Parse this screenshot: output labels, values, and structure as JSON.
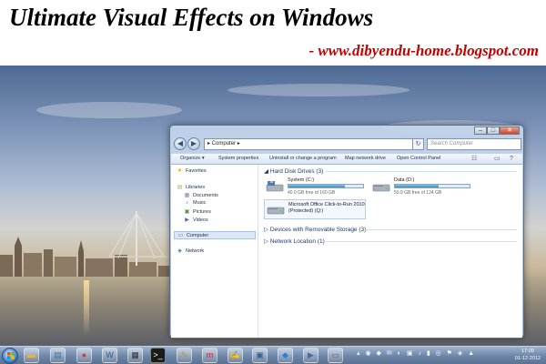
{
  "banner": {
    "title": "Ultimate Visual Effects on Windows",
    "url": "- www.dibyendu-home.blogspot.com"
  },
  "explorer": {
    "address": "▸ Computer ▸",
    "search_placeholder": "Search Computer",
    "toolbar": {
      "organize": "Organize ▾",
      "system_properties": "System properties",
      "uninstall": "Uninstall or change a program",
      "map_drive": "Map network drive",
      "control_panel": "Open Control Panel"
    },
    "sidebar": {
      "favorites": "Favorites",
      "libraries": "Libraries",
      "documents": "Documents",
      "music": "Music",
      "pictures": "Pictures",
      "videos": "Videos",
      "computer": "Computer",
      "network": "Network"
    },
    "groups": {
      "hard_disk": "Hard Disk Drives (3)",
      "removable": "Devices with Removable Storage (3)",
      "network_location": "Network Location (1)"
    },
    "drives": [
      {
        "name": "System (C:)",
        "free": "40.0 GB free of 160 GB",
        "used_fraction": 0.75
      },
      {
        "name": "Data (D:)",
        "free": "50.9 GB free of 124 GB",
        "used_fraction": 0.59
      },
      {
        "name": "Microsoft Office Click-to-Run 2010",
        "name2": "(Protected) (Q:)"
      }
    ]
  },
  "taskbar": {
    "time": "17:09",
    "date": "01-12-2012",
    "icons": [
      "windows-explorer",
      "notepad",
      "chrome",
      "word",
      "calculator",
      "command-prompt",
      "paint",
      "opera",
      "notepad-plus",
      "control-panel",
      "dropbox",
      "media",
      "window"
    ]
  }
}
